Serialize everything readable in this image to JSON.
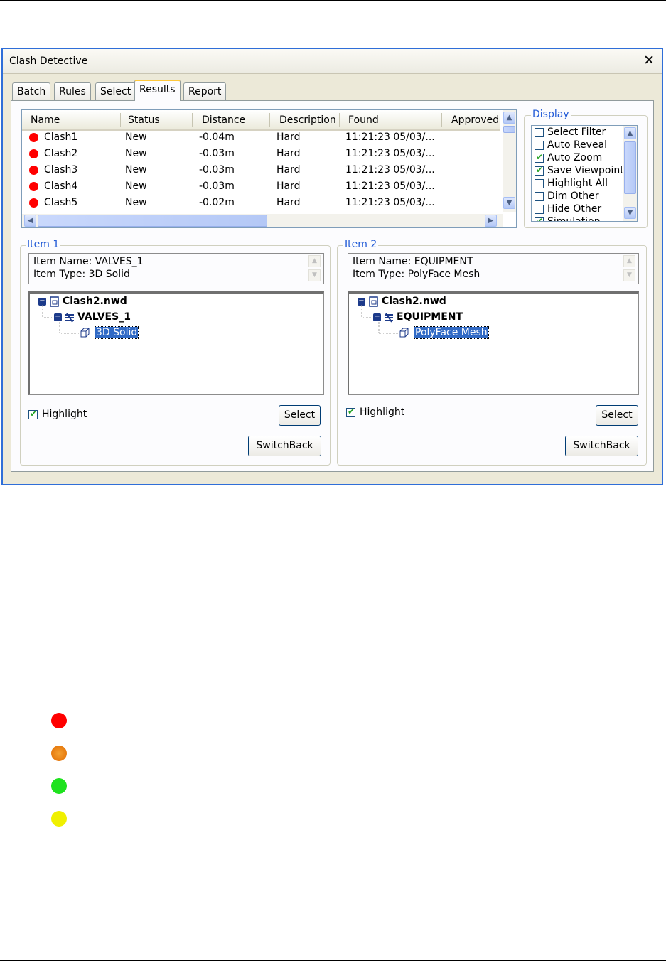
{
  "window": {
    "title": "Clash Detective"
  },
  "tabs": [
    {
      "label": "Batch",
      "active": false
    },
    {
      "label": "Rules",
      "active": false
    },
    {
      "label": "Select",
      "active": false
    },
    {
      "label": "Results",
      "active": true
    },
    {
      "label": "Report",
      "active": false
    }
  ],
  "results": {
    "columns": [
      "Name",
      "Status",
      "Distance",
      "Description",
      "Found",
      "Approved"
    ],
    "rows": [
      {
        "name": "Clash1",
        "status": "New",
        "distance": "-0.04m",
        "description": "Hard",
        "found": "11:21:23 05/03/...",
        "status_color": "#ff0000"
      },
      {
        "name": "Clash2",
        "status": "New",
        "distance": "-0.03m",
        "description": "Hard",
        "found": "11:21:23 05/03/...",
        "status_color": "#ff0000"
      },
      {
        "name": "Clash3",
        "status": "New",
        "distance": "-0.03m",
        "description": "Hard",
        "found": "11:21:23 05/03/...",
        "status_color": "#ff0000"
      },
      {
        "name": "Clash4",
        "status": "New",
        "distance": "-0.03m",
        "description": "Hard",
        "found": "11:21:23 05/03/...",
        "status_color": "#ff0000"
      },
      {
        "name": "Clash5",
        "status": "New",
        "distance": "-0.02m",
        "description": "Hard",
        "found": "11:21:23 05/03/...",
        "status_color": "#ff0000"
      }
    ]
  },
  "display": {
    "title": "Display",
    "options": [
      {
        "label": "Select Filter",
        "checked": false
      },
      {
        "label": "Auto Reveal",
        "checked": false
      },
      {
        "label": "Auto Zoom",
        "checked": true
      },
      {
        "label": "Save Viewpoint",
        "checked": true
      },
      {
        "label": "Highlight All",
        "checked": false
      },
      {
        "label": "Dim Other",
        "checked": false
      },
      {
        "label": "Hide Other",
        "checked": false
      },
      {
        "label": "Simulation",
        "checked": true
      }
    ]
  },
  "item1": {
    "title": "Item 1",
    "name_line": "Item Name: VALVES_1",
    "type_line": "Item Type: 3D Solid",
    "tree": {
      "file": "Clash2.nwd",
      "layer": "VALVES_1",
      "object": "3D Solid"
    },
    "highlight_label": "Highlight",
    "highlight_checked": true,
    "select_label": "Select",
    "switchback_label": "SwitchBack"
  },
  "item2": {
    "title": "Item 2",
    "name_line": "Item Name: EQUIPMENT",
    "type_line": "Item Type: PolyFace Mesh",
    "tree": {
      "file": "Clash2.nwd",
      "layer": "EQUIPMENT",
      "object": "PolyFace Mesh"
    },
    "highlight_label": "Highlight",
    "highlight_checked": true,
    "select_label": "Select",
    "switchback_label": "SwitchBack"
  },
  "status_legend_colors": [
    "#ff0000",
    "#f07a10",
    "#1ee21e",
    "#f0f000"
  ],
  "colors": {
    "accent": "#316ac5",
    "window_border": "#2f6ed8",
    "group_title": "#1e58d6"
  }
}
